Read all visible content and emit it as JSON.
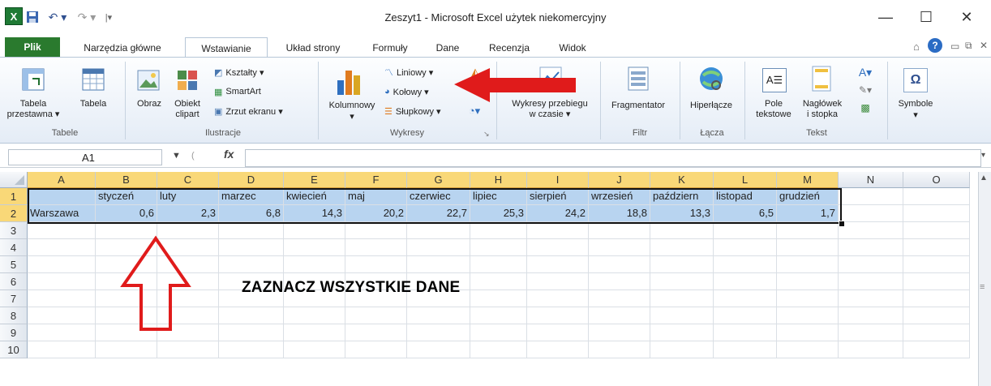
{
  "window": {
    "title": "Zeszyt1  -  Microsoft Excel użytek niekomercyjny",
    "controls": [
      "—",
      "☐",
      "✕"
    ]
  },
  "tabs": [
    "Plik",
    "Narzędzia główne",
    "Wstawianie",
    "Układ strony",
    "Formuły",
    "Dane",
    "Recenzja",
    "Widok"
  ],
  "active_tab": "Wstawianie",
  "ribbon": {
    "tables": {
      "pivot": "Tabela\nprzestawna ▾",
      "table": "Tabela",
      "group": "Tabele"
    },
    "illustrations": {
      "picture": "Obraz",
      "clipart": "Obiekt\nclipart",
      "shapes": "Kształty ▾",
      "smartart": "SmartArt",
      "screenshot": "Zrzut ekranu ▾",
      "group": "Ilustracje"
    },
    "charts": {
      "column": "Kolumnowy",
      "line": "Liniowy ▾",
      "pie": "Kołowy ▾",
      "bar": "Słupkowy ▾",
      "group": "Wykresy"
    },
    "sparklines": {
      "label": "Wykresy przebiegu\nw czasie ▾"
    },
    "filter": {
      "slicer": "Fragmentator",
      "group": "Filtr"
    },
    "links": {
      "hyperlink": "Hiperłącze",
      "group": "Łącza"
    },
    "text": {
      "textbox": "Pole\ntekstowe",
      "header": "Nagłówek\ni stopka",
      "group": "Tekst"
    },
    "symbols": {
      "label": "Symbole"
    }
  },
  "formula_bar": {
    "name_box": "A1",
    "fx": "fx",
    "value": ""
  },
  "columns": [
    "A",
    "B",
    "C",
    "D",
    "E",
    "F",
    "G",
    "H",
    "I",
    "J",
    "K",
    "L",
    "M",
    "N",
    "O"
  ],
  "rows": [
    "1",
    "2",
    "3",
    "4",
    "5",
    "6",
    "7",
    "8",
    "9",
    "10"
  ],
  "row1": [
    "",
    "styczeń",
    "luty",
    "marzec",
    "kwiecień",
    "maj",
    "czerwiec",
    "lipiec",
    "sierpień",
    "wrzesień",
    "październ",
    "listopad",
    "grudzień"
  ],
  "row2": [
    "Warszawa",
    "0,6",
    "2,3",
    "6,8",
    "14,3",
    "20,2",
    "22,7",
    "25,3",
    "24,2",
    "18,8",
    "13,3",
    "6,5",
    "1,7"
  ],
  "instruction": "ZAZNACZ WSZYSTKIE DANE",
  "colors": {
    "file_tab": "#2a7a2e",
    "selection": "#b8d4f0",
    "header_selected": "#f9d878",
    "arrow": "#e01b1b"
  }
}
